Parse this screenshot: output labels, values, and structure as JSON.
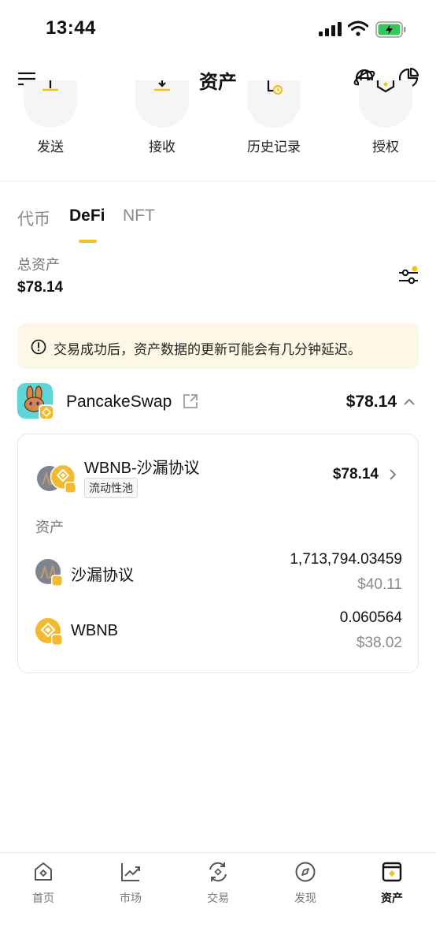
{
  "status_bar": {
    "time": "13:44"
  },
  "header": {
    "title": "资产"
  },
  "quick_actions": [
    {
      "label": "发送",
      "icon": "send-icon"
    },
    {
      "label": "接收",
      "icon": "receive-icon"
    },
    {
      "label": "历史记录",
      "icon": "history-icon"
    },
    {
      "label": "授权",
      "icon": "authorize-icon"
    }
  ],
  "tabs": [
    {
      "label": "代币",
      "active": false
    },
    {
      "label": "DeFi",
      "active": true
    },
    {
      "label": "NFT",
      "active": false
    }
  ],
  "summary": {
    "label": "总资产",
    "value": "$78.14"
  },
  "notice": {
    "text": "交易成功后，资产数据的更新可能会有几分钟延迟。"
  },
  "protocol": {
    "name": "PancakeSwap",
    "value": "$78.14",
    "pool": {
      "name": "WBNB-沙漏协议",
      "tag": "流动性池",
      "value": "$78.14",
      "assets_label": "资产",
      "assets": [
        {
          "name": "沙漏协议",
          "amount": "1,713,794.03459",
          "usd": "$40.11",
          "icon": "hourglass-token-icon"
        },
        {
          "name": "WBNB",
          "amount": "0.060564",
          "usd": "$38.02",
          "icon": "bnb-token-icon"
        }
      ]
    }
  },
  "bottom_nav": [
    {
      "label": "首页",
      "icon": "home-icon",
      "active": false
    },
    {
      "label": "市场",
      "icon": "market-icon",
      "active": false
    },
    {
      "label": "交易",
      "icon": "trade-icon",
      "active": false
    },
    {
      "label": "发现",
      "icon": "discover-icon",
      "active": false
    },
    {
      "label": "资产",
      "icon": "assets-icon",
      "active": true
    }
  ],
  "colors": {
    "accent": "#F0C419",
    "bnb": "#F3BA2F",
    "notice_bg": "#FDF8E6",
    "pancake": "#5FD4D9"
  }
}
